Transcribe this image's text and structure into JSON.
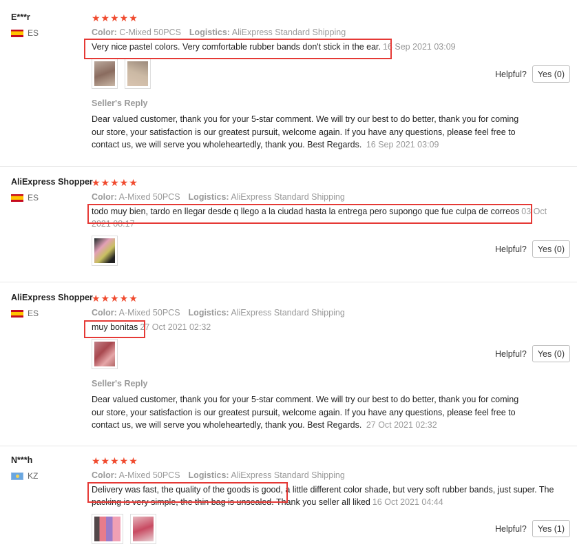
{
  "labels": {
    "color": "Color:",
    "logistics": "Logistics:",
    "helpful": "Helpful?",
    "seller_reply": "Seller's Reply",
    "stars": "★★★★★"
  },
  "icons": {
    "flag_es": "spain-flag-icon",
    "flag_kz": "kazakhstan-flag-icon"
  },
  "highlight_color": "#e53935",
  "reviews": [
    {
      "user": "E***r",
      "country": "ES",
      "rating": 5,
      "color": "C-Mixed 50PCS",
      "logistics": "AliExpress Standard Shipping",
      "text": "Very nice pastel colors. Very comfortable rubber bands don't stick in the ear.",
      "date": "16 Sep 2021 03:09",
      "yes": "Yes (0)",
      "reply": "Dear valued customer, thank you for your 5-star comment. We will try our best to do better, thank you for coming our store, your satisfaction is our greatest pursuit, welcome again. If you have any questions, please feel free to contact us, we will serve you wholeheartedly, thank you. Best Regards.",
      "reply_date": "16 Sep 2021 03:09"
    },
    {
      "user": "AliExpress Shopper",
      "country": "ES",
      "rating": 5,
      "color": "A-Mixed 50PCS",
      "logistics": "AliExpress Standard Shipping",
      "text": "todo muy bien, tardo en llegar desde q llego a la ciudad hasta la entrega pero supongo que fue culpa de correos",
      "date": "03 Oct 2021 08:17",
      "yes": "Yes (0)"
    },
    {
      "user": "AliExpress Shopper",
      "country": "ES",
      "rating": 5,
      "color": "A-Mixed 50PCS",
      "logistics": "AliExpress Standard Shipping",
      "text": "muy bonitas",
      "date": "27 Oct 2021 02:32",
      "yes": "Yes (0)",
      "reply": "Dear valued customer, thank you for your 5-star comment. We will try our best to do better, thank you for coming our store, your satisfaction is our greatest pursuit, welcome again. If you have any questions, please feel free to contact us, we will serve you wholeheartedly, thank you. Best Regards.",
      "reply_date": "27 Oct 2021 02:32"
    },
    {
      "user": "N***h",
      "country": "KZ",
      "rating": 5,
      "color": "A-Mixed 50PCS",
      "logistics": "AliExpress Standard Shipping",
      "text": "Delivery was fast, the quality of the goods is good, a little different color shade, but very soft rubber bands, just super. The packing is very simple, the thin bag is unsealed. Thank you seller all liked",
      "date": "16 Oct 2021 04:44",
      "yes": "Yes (1)"
    }
  ]
}
